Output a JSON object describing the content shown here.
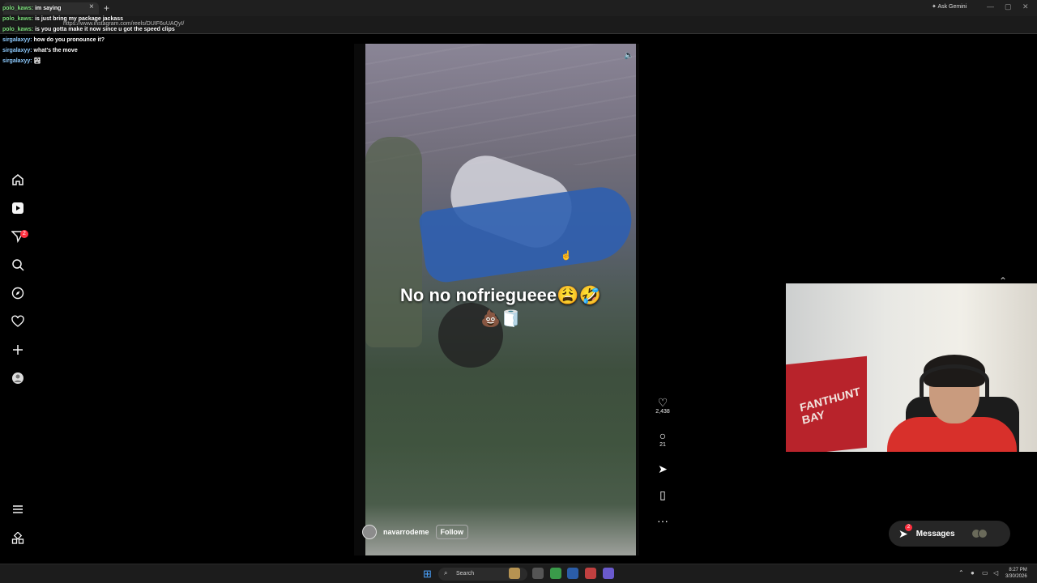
{
  "browser": {
    "tab_title": "Instagram",
    "url": "https://www.instagram.com/reels/DUIF6uUAQyI/",
    "gemini_label": "Ask Gemini",
    "new_tab": "+",
    "tab_close": "×"
  },
  "chat": [
    {
      "user": "polo_kaws",
      "message": "im saying",
      "color": "#7ee07e"
    },
    {
      "user": "polo_kaws",
      "message": "is just bring my package jackass",
      "color": "#7ee07e"
    },
    {
      "user": "polo_kaws",
      "message": "is you gotta make it now since u got the speed clips",
      "color": "#7ee07e"
    },
    {
      "user": "sirgalaxyy",
      "message": "how do you pronounce it?",
      "color": "#8ecbff"
    },
    {
      "user": "sirgalaxyy",
      "message": "what's the move",
      "color": "#8ecbff"
    },
    {
      "user": "sirgalaxyy",
      "message": "🏞",
      "color": "#8ecbff"
    }
  ],
  "sidebar": {
    "icons": [
      "home-icon",
      "reels-icon",
      "messages-icon",
      "search-icon",
      "explore-icon",
      "notifications-icon",
      "create-icon",
      "profile-icon",
      "menu-icon",
      "more-icon"
    ],
    "messages_badge": "2"
  },
  "reel": {
    "caption": "No no nofriegueee😩🤣",
    "caption_emoji": "💩🧻",
    "username": "navarrodeme",
    "follow_label": "Follow",
    "likes": "2,438",
    "comments": "21"
  },
  "messages_bar": {
    "label": "Messages",
    "badge": "2"
  },
  "webcam": {
    "flag_text": "FANTHUNT BAY"
  },
  "taskbar": {
    "search_label": "Search",
    "time": "8:27 PM",
    "date": "3/30/2026"
  }
}
